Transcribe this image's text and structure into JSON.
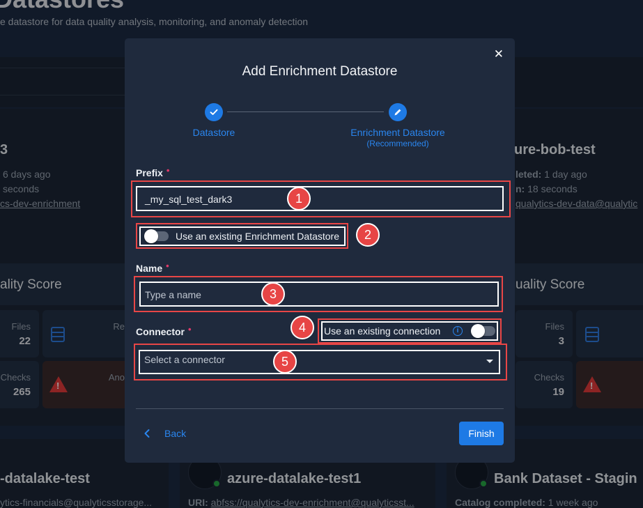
{
  "background": {
    "page_title": "Datastores",
    "page_subtitle": "e datastore for data quality analysis, monitoring, and anomaly detection",
    "left_card": {
      "title": "3",
      "line1": "6 days ago",
      "line2": "seconds",
      "line3": "cs-dev-enrichment",
      "score_label": "ality Score",
      "files_label": "Files",
      "files_value": "22",
      "reports_label": "Re",
      "checks_label": "Checks",
      "checks_value": "265",
      "anomalies_label": "Ano"
    },
    "right_card": {
      "title": "ure-bob-test",
      "line1_label": "leted:",
      "line1_value": "1 day ago",
      "line2_label": "n:",
      "line2_value": "18 seconds",
      "line3": "qualytics-dev-data@qualytic",
      "score_label": "uality Score",
      "files_label": "Files",
      "files_value": "3",
      "checks_label": "Checks",
      "checks_value": "19"
    },
    "bottom_cards": [
      {
        "title": "-datalake-test",
        "uri": "ytics-financials@qualyticsstorage..."
      },
      {
        "title": "azure-datalake-test1",
        "uri_label": "URI:",
        "uri_value": "abfss://qualytics-dev-enrichment@qualyticsst..."
      },
      {
        "title": "Bank Dataset - Stagin",
        "status_label": "Catalog completed:",
        "status_value": "1 week ago"
      }
    ]
  },
  "modal": {
    "title": "Add Enrichment Datastore",
    "close_icon": "close-icon",
    "steps": [
      {
        "label": "Datastore",
        "sub": "",
        "icon": "check-icon"
      },
      {
        "label": "Enrichment Datastore",
        "sub": "(Recommended)",
        "icon": "pencil-icon"
      }
    ],
    "prefix": {
      "label": "Prefix",
      "required_mark": "•",
      "value": "_my_sql_test_dark3"
    },
    "use_existing_enrichment": {
      "label": "Use an existing Enrichment Datastore",
      "checked": false
    },
    "name": {
      "label": "Name",
      "required_mark": "•",
      "placeholder": "Type a name"
    },
    "connector": {
      "label": "Connector",
      "required_mark": "•",
      "placeholder": "Select a connector"
    },
    "use_existing_connection": {
      "label": "Use an existing connection",
      "info_icon": "i",
      "checked": false
    },
    "annotations": [
      "1",
      "2",
      "3",
      "4",
      "5"
    ],
    "back_label": "Back",
    "finish_label": "Finish",
    "colors": {
      "accent": "#1e7ae5",
      "annotation": "#e84646",
      "required": "#e03a6a",
      "modal_bg": "#1f2a3d"
    }
  }
}
